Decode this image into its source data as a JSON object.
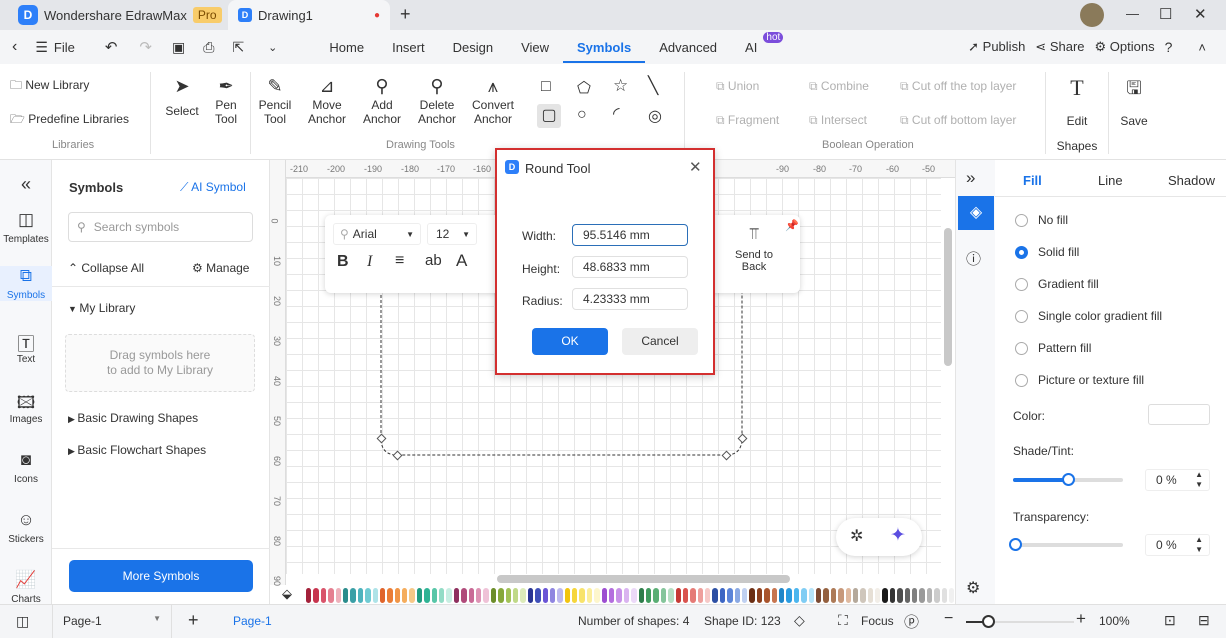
{
  "app": {
    "name": "Wondershare EdrawMax",
    "badge": "Pro",
    "doc_tab": "Drawing1",
    "new_tab": "+"
  },
  "window": {
    "minimize": "—",
    "maximize": "☐",
    "close": "✕"
  },
  "menubar": {
    "file": "File",
    "tabs": [
      "Home",
      "Insert",
      "Design",
      "View",
      "Symbols",
      "Advanced",
      "AI"
    ],
    "active": "Symbols",
    "ai_badge": "hot",
    "publish": "Publish",
    "share": "Share",
    "options": "Options"
  },
  "ribbon": {
    "libraries": {
      "new": "New Library",
      "predefine": "Predefine Libraries",
      "group": "Libraries"
    },
    "drawing_tools": {
      "items": [
        "Select",
        "Pen\nTool",
        "Pencil\nTool",
        "Move\nAnchor",
        "Add\nAnchor",
        "Delete\nAnchor",
        "Convert\nAnchor"
      ],
      "group": "Drawing Tools"
    },
    "boolean": {
      "items": [
        "Union",
        "Combine",
        "Cut off the top layer",
        "Fragment",
        "Intersect",
        "Cut off bottom layer"
      ],
      "group": "Boolean Operation"
    },
    "edit_shapes": {
      "line1": "Edit",
      "line2": "Shapes"
    },
    "save": "Save"
  },
  "leftrail": [
    "Templates",
    "Symbols",
    "Text",
    "Images",
    "Icons",
    "Stickers",
    "Charts"
  ],
  "symbols_panel": {
    "title": "Symbols",
    "ai_symbol": "AI Symbol",
    "search_placeholder": "Search symbols",
    "collapse_all": "Collapse All",
    "manage": "Manage",
    "my_library": "My Library",
    "drop_hint": "Drag symbols here\nto add to My Library",
    "sections": [
      "Basic Drawing Shapes",
      "Basic Flowchart Shapes"
    ],
    "more": "More Symbols"
  },
  "ruler": {
    "top": [
      "-210",
      "-200",
      "-190",
      "-180",
      "-170",
      "-160",
      "-90",
      "-80",
      "-70",
      "-60",
      "-50",
      "-40"
    ],
    "left": [
      "0",
      "10",
      "20",
      "30",
      "40",
      "50",
      "60",
      "70",
      "80",
      "90",
      "100"
    ]
  },
  "floatbar": {
    "font": "Arial",
    "size": "12",
    "send_to_back": "Send to\nBack"
  },
  "dialog": {
    "title": "Round Tool",
    "width_label": "Width:",
    "width": "95.5146 mm",
    "height_label": "Height:",
    "height": "48.6833 mm",
    "radius_label": "Radius:",
    "radius": "4.23333 mm",
    "ok": "OK",
    "cancel": "Cancel"
  },
  "right_panel": {
    "tabs": [
      "Fill",
      "Line",
      "Shadow"
    ],
    "active": "Fill",
    "options": [
      "No fill",
      "Solid fill",
      "Gradient fill",
      "Single color gradient fill",
      "Pattern fill",
      "Picture or texture fill"
    ],
    "selected": "Solid fill",
    "color_label": "Color:",
    "shade_label": "Shade/Tint:",
    "shade_value": "0 %",
    "shade_slider": 0.5,
    "transparency_label": "Transparency:",
    "transparency_value": "0 %",
    "transparency_slider": 0
  },
  "status": {
    "page_select": "Page-1",
    "page_tab": "Page-1",
    "shapes": "Number of shapes: 4",
    "shape_id": "Shape ID: 123",
    "focus": "Focus",
    "zoom": "100%"
  },
  "colors": {
    "accent": "#1a73e8",
    "dialog_border": "#d32f2f"
  },
  "palette": [
    "#a3213a",
    "#c7344e",
    "#d9546b",
    "#e57f90",
    "#eeb1bb",
    "#2b8c8c",
    "#3a9fa6",
    "#4db3bd",
    "#6fcbd3",
    "#aee3e8",
    "#e0642b",
    "#ea7c35",
    "#f19546",
    "#f5ad5d",
    "#f6c887",
    "#229b80",
    "#2eb394",
    "#58c6a8",
    "#93dcc6",
    "#c7eee2",
    "#8e2f5e",
    "#b04a7a",
    "#c96a96",
    "#dd92b4",
    "#efc2d7",
    "#6c8d2a",
    "#86a83a",
    "#a2c257",
    "#c0d989",
    "#dcebb9",
    "#2a3593",
    "#3f4fb8",
    "#6a55d6",
    "#8f85e0",
    "#bdb8ee",
    "#f2c40f",
    "#f6d63c",
    "#f8e36b",
    "#fbee9c",
    "#fdf6cc",
    "#9d4ed1",
    "#b46ede",
    "#c891e8",
    "#dab4f0",
    "#ecd9f8",
    "#2e7d4a",
    "#3f9a5d",
    "#5aae74",
    "#85c59b",
    "#b6dfc3",
    "#c63a35",
    "#d9534f",
    "#e57a76",
    "#ee9f9c",
    "#f6c9c7",
    "#2c4fa3",
    "#3c66c4",
    "#5b84d8",
    "#8aa9e4",
    "#bfd0f1",
    "#6b2e13",
    "#8c3f1d",
    "#a9542c",
    "#c7754f",
    "#1f86c9",
    "#2a9be0",
    "#4cb6ee",
    "#80cdf4",
    "#b5e3f9",
    "#7b4a33",
    "#94603f",
    "#ad7a57",
    "#c7987a",
    "#dfb99f",
    "#b5a99b",
    "#cfc6bb",
    "#e6dfd5",
    "#f2eee8",
    "#1a1a1a",
    "#333",
    "#4d4d4d",
    "#666",
    "#808080",
    "#999",
    "#b3b3b3",
    "#ccc",
    "#e0e0e0",
    "#f0f0f0"
  ],
  "icons": {
    "undo": "undo-icon",
    "redo": "redo-icon",
    "save": "save-icon",
    "print": "print-icon",
    "export": "export-icon"
  }
}
